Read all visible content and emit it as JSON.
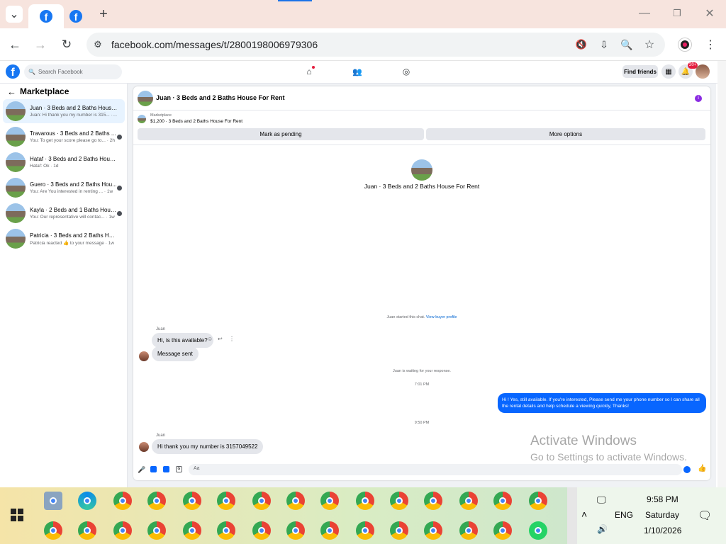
{
  "browser": {
    "tabs": [
      {
        "icon": "facebook-icon"
      },
      {
        "icon": "facebook-icon"
      }
    ],
    "new_tab": "+",
    "url": "facebook.com/messages/t/2800198006979306",
    "window_controls": {
      "minimize": "—",
      "restore": "❐",
      "close": "✕"
    }
  },
  "fb": {
    "search_placeholder": "Search Facebook",
    "find_friends": "Find friends",
    "notif_badge": "20+"
  },
  "sidebar": {
    "title": "Marketplace",
    "conversations": [
      {
        "title": "Juan · 3 Beds and 2 Baths House F...",
        "snippet": "Juan: Hi thank you my number is 315... · 8m",
        "selected": true
      },
      {
        "title": "Travarous · 3 Beds and 2 Baths ...",
        "snippet": "You: To get your score please go to... · 2h"
      },
      {
        "title": "Hataf · 3 Beds and 2 Baths House ...",
        "snippet": "Hataf: Ok · 1d"
      },
      {
        "title": "Guero · 3 Beds and 2 Baths Hou...",
        "snippet": "You: Are You interested in renting ... · 1w"
      },
      {
        "title": "Kayla · 2 Beds and 1 Baths Hous...",
        "snippet": "You: Our representative will contac... · 1w"
      },
      {
        "title": "Patricia · 3 Beds and 2 Baths Hous...",
        "snippet": "Patricia reacted 👍 to your message · 1w"
      }
    ]
  },
  "chat": {
    "header_title": "Juan · 3 Beds and 2 Baths House For Rent",
    "listing_label": "Marketplace",
    "listing_info": "$1,200 · 3 Beds and 2 Baths House For Rent",
    "mark_pending": "Mark as pending",
    "more_options": "More options",
    "center_title": "Juan · 3 Beds and 2 Baths House For Rent",
    "started_text": "Juan started this chat.",
    "view_profile": "View buyer profile",
    "sender1": "Juan",
    "msg1": "Hi, is this available?",
    "msg2": "Message sent",
    "waiting": "Juan is waiting for your response.",
    "time1": "7:01 PM",
    "my_msg": "Hi ! Yes, still available. If you're interested, Please send me your phone number so I can share all the rental details and help schedule a viewing quickly, Thanks!",
    "time2": "9:50 PM",
    "sender2": "Juan",
    "msg3": "Hi thank you my number is 3157049522",
    "composer_placeholder": "Aa"
  },
  "watermark": {
    "line1": "Activate Windows",
    "line2": "Go to Settings to activate Windows."
  },
  "tray": {
    "lang": "ENG",
    "time": "9:58 PM",
    "day": "Saturday",
    "date": "1/10/2026"
  }
}
